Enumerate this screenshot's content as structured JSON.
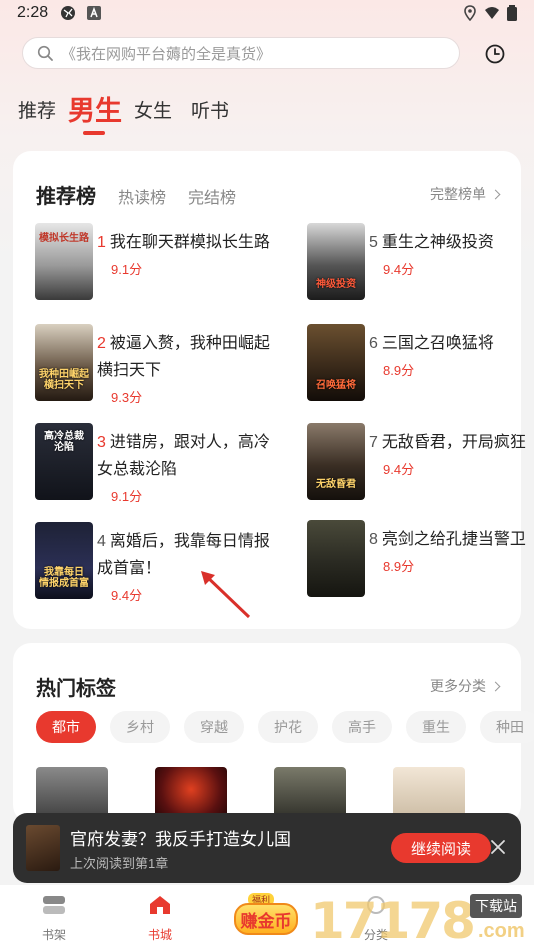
{
  "status_bar": {
    "time": "2:28"
  },
  "search": {
    "placeholder": "《我在网购平台薅的全是真货》"
  },
  "channel_tabs": [
    {
      "label": "推荐"
    },
    {
      "label": "男生"
    },
    {
      "label": "女生"
    },
    {
      "label": "听书"
    }
  ],
  "rank": {
    "tabs": [
      {
        "label": "推荐榜"
      },
      {
        "label": "热读榜"
      },
      {
        "label": "完结榜"
      }
    ],
    "more": "完整榜单",
    "books": [
      {
        "num": "1",
        "title": "我在聊天群模拟长生路",
        "score": "9.1分",
        "cover_text": "模拟长生路"
      },
      {
        "num": "2",
        "title": "被逼入赘，我种田崛起横扫天下",
        "score": "9.3分",
        "cover_text": "我种田崛起 横扫天下"
      },
      {
        "num": "3",
        "title": "进错房，跟对人，高冷女总裁沦陷",
        "score": "9.1分",
        "cover_text": "高冷总裁 沦陷"
      },
      {
        "num": "4",
        "title": "离婚后，我靠每日情报成首富！",
        "score": "9.4分",
        "cover_text": "我靠每日 情报成首富"
      },
      {
        "num": "5",
        "title": "重生之神级投资",
        "score": "9.4分",
        "cover_text": "神级投资"
      },
      {
        "num": "6",
        "title": "三国之召唤猛将",
        "score": "8.9分",
        "cover_text": "召唤猛将"
      },
      {
        "num": "7",
        "title": "无敌昏君，开局疯狂",
        "score": "9.4分",
        "cover_text": "无敌昏君"
      },
      {
        "num": "8",
        "title": "亮剑之给孔捷当警卫",
        "score": "8.9分",
        "cover_text": ""
      }
    ]
  },
  "tags": {
    "title": "热门标签",
    "more": "更多分类",
    "items": [
      {
        "label": "都市"
      },
      {
        "label": "乡村"
      },
      {
        "label": "穿越"
      },
      {
        "label": "护花"
      },
      {
        "label": "高手"
      },
      {
        "label": "重生"
      },
      {
        "label": "种田"
      }
    ]
  },
  "continue_reading": {
    "title": "官府发妻？我反手打造女儿国",
    "subtitle": "上次阅读到第1章",
    "button": "继续阅读"
  },
  "bottom_nav": {
    "bookshelf": "书架",
    "store": "书城",
    "coin_badge": "赚金币",
    "coin_tip": "福利",
    "category": "分类"
  },
  "watermark": {
    "number": "17178",
    "brand": "下载站",
    "domain": ".com"
  },
  "colors": {
    "accent": "#e8392e",
    "banner_bg": "#2f2f2f"
  }
}
